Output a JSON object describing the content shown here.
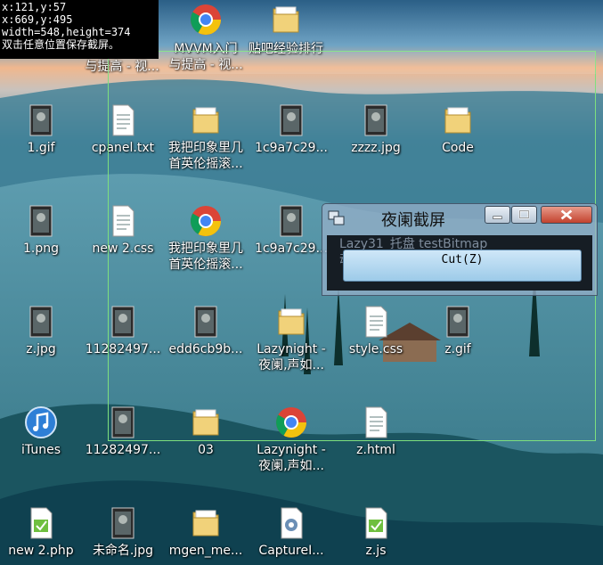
{
  "overlay": {
    "lines": [
      "x:121,y:57",
      "x:669,y:495",
      "width=548,height=374",
      "双击任意位置保存截屏。"
    ]
  },
  "desktop_icons": [
    {
      "name": "icon-video-url",
      "icon": "url-link-icon",
      "label": "与提高 - 视..."
    },
    {
      "name": "icon-mvvm-chrome",
      "icon": "chrome-icon",
      "label": "MVVM入门\n与提高 - 视..."
    },
    {
      "name": "icon-tieba-folder",
      "icon": "folder-icon",
      "label": "贴吧经验排行"
    },
    {
      "name": "icon-1-gif",
      "icon": "image-icon",
      "label": "1.gif"
    },
    {
      "name": "icon-cpanel-txt",
      "icon": "text-file-icon",
      "label": "cpanel.txt"
    },
    {
      "name": "icon-folder-song",
      "icon": "folder-icon",
      "label": "我把印象里几\n首英伦摇滚..."
    },
    {
      "name": "icon-1c9a7c29-1",
      "icon": "image-icon",
      "label": "1c9a7c29..."
    },
    {
      "name": "icon-zzzz-jpg",
      "icon": "image-icon",
      "label": "zzzz.jpg"
    },
    {
      "name": "icon-code-folder",
      "icon": "folder-icon",
      "label": "Code"
    },
    {
      "name": "icon-1-png",
      "icon": "image-icon",
      "label": "1.png"
    },
    {
      "name": "icon-new2-css",
      "icon": "text-file-icon",
      "label": "new  2.css"
    },
    {
      "name": "icon-chrome-song",
      "icon": "chrome-icon",
      "label": "我把印象里几\n首英伦摇滚..."
    },
    {
      "name": "icon-1c9a7c29-2",
      "icon": "image-icon",
      "label": "1c9a7c29..."
    },
    {
      "name": "icon-z-jpg",
      "icon": "image-icon",
      "label": "z.jpg"
    },
    {
      "name": "icon-11282497-1",
      "icon": "image-icon",
      "label": "11282497..."
    },
    {
      "name": "icon-edd6cb9b",
      "icon": "image-icon",
      "label": "edd6cb9b..."
    },
    {
      "name": "icon-lazynight-folder",
      "icon": "folder-icon",
      "label": "Lazynight -\n夜阑,声如..."
    },
    {
      "name": "icon-style-css",
      "icon": "text-file-icon",
      "label": "style.css"
    },
    {
      "name": "icon-z-gif",
      "icon": "image-icon",
      "label": "z.gif"
    },
    {
      "name": "icon-itunes",
      "icon": "itunes-icon",
      "label": "iTunes"
    },
    {
      "name": "icon-11282497-2",
      "icon": "image-icon",
      "label": "11282497..."
    },
    {
      "name": "icon-03-folder",
      "icon": "folder-icon",
      "label": "03"
    },
    {
      "name": "icon-lazynight-chrome",
      "icon": "chrome-icon",
      "label": "Lazynight -\n夜阑,声如..."
    },
    {
      "name": "icon-z-html",
      "icon": "text-file-icon",
      "label": "z.html"
    },
    {
      "name": "icon-new2-php",
      "icon": "script-file-icon",
      "label": "new  2.php"
    },
    {
      "name": "icon-weimingming-jpg",
      "icon": "image-icon",
      "label": "未命名.jpg"
    },
    {
      "name": "icon-mgen-folder",
      "icon": "folder-icon",
      "label": "mgen_me..."
    },
    {
      "name": "icon-capture-exe",
      "icon": "gear-app-icon",
      "label": "CaptureI..."
    },
    {
      "name": "icon-z-js",
      "icon": "script-file-icon",
      "label": "z.js"
    }
  ],
  "window": {
    "title": "夜阑截屏",
    "ghost_text": "Lazy31_托盘  testBitmap\n动画图标",
    "button_label": "Cut(Z)",
    "controls": {
      "minimize": "minimize-icon",
      "maximize": "maximize-icon",
      "close": "close-icon"
    }
  },
  "colors": {
    "selection_border": "#7ee07e",
    "sky_top": "#2b5f86",
    "horizon": "#f0b78e",
    "hills": "#0f4150",
    "button_fill": "#b8dcf3"
  }
}
